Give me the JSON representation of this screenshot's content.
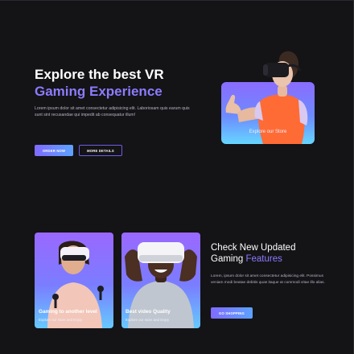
{
  "hero": {
    "title_line1": "Explore the best VR",
    "title_line2": "Gaming Experience",
    "description": "Lorem ipsum dolor sit amet consectetur adipisicing elit. Laboriosam quis earum quis sunt sint recusandae qui impedit ab consequatur illum!",
    "order_label": "ORDER NOW",
    "more_label": "MORE DETAILS",
    "card_label": "Explore our Store"
  },
  "features": {
    "cards": [
      {
        "title": "Gaming to another level",
        "subtitle": "Explore our store and Enjoy"
      },
      {
        "title": "Best video Quality",
        "subtitle": "Explore our store and Enjoy"
      }
    ],
    "title_plain": "Check New Updated",
    "title_line2_plain": "Gaming",
    "title_accent": "Features",
    "description": "Lorem, ipsum dolor sit amet consectetur adipisicing elit. Possimus veniam modi beatae debitis quas itaque at commodi vitae illo alias.",
    "shop_label": "GO SHOPPING"
  },
  "colors": {
    "background": "#141316",
    "accent": "#8b7cff",
    "gradient_start": "#7f6bff",
    "gradient_end": "#5da2ff"
  }
}
